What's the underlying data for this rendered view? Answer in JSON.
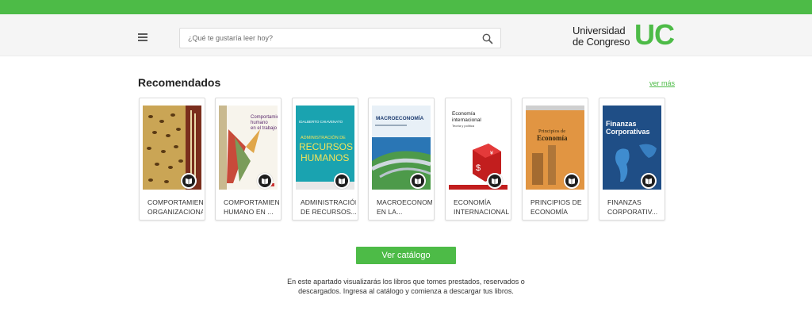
{
  "header": {
    "search_placeholder": "¿Qué te gustaría leer hoy?",
    "logo_line1": "Universidad",
    "logo_line2": "de Congreso",
    "logo_mark": "UC"
  },
  "recommended": {
    "title": "Recomendados",
    "see_more": "ver más",
    "books": [
      {
        "line1": "COMPORTAMIENTO",
        "line2": "ORGANIZACIONAL"
      },
      {
        "line1": "COMPORTAMIENTO",
        "line2": "HUMANO EN ..."
      },
      {
        "line1": "ADMINISTRACIÓN",
        "line2": "DE RECURSOS..."
      },
      {
        "line1": "MACROECONOMÍA",
        "line2": "EN LA..."
      },
      {
        "line1": "ECONOMÍA",
        "line2": "INTERNACIONAL"
      },
      {
        "line1": "PRINCIPIOS DE",
        "line2": "ECONOMÍA"
      },
      {
        "line1": "FINANZAS",
        "line2": "CORPORATIV..."
      }
    ],
    "covers": {
      "c3_author": "IDALBERTO CHIAVENATO",
      "c3_l1": "ADMINISTRACIÓN DE",
      "c3_l2": "RECURSOS",
      "c3_l3": "HUMANOS",
      "c4_title": "MACROECONOMÍA",
      "c5_l1": "Economía",
      "c5_l2": "internacional",
      "c5_l3": "Teoría y política",
      "c6_l1": "Principios de",
      "c6_l2": "Economía",
      "c7_l1": "Finanzas",
      "c7_l2": "Corporativas"
    }
  },
  "catalog_button": "Ver catálogo",
  "description": "En este apartado visualizarás los libros que tomes prestados, reservados o descargados. Ingresa al catálogo y comienza a descargar tus libros.",
  "colors": {
    "accent": "#4dbb47",
    "header_bg": "#f5f5f5"
  }
}
